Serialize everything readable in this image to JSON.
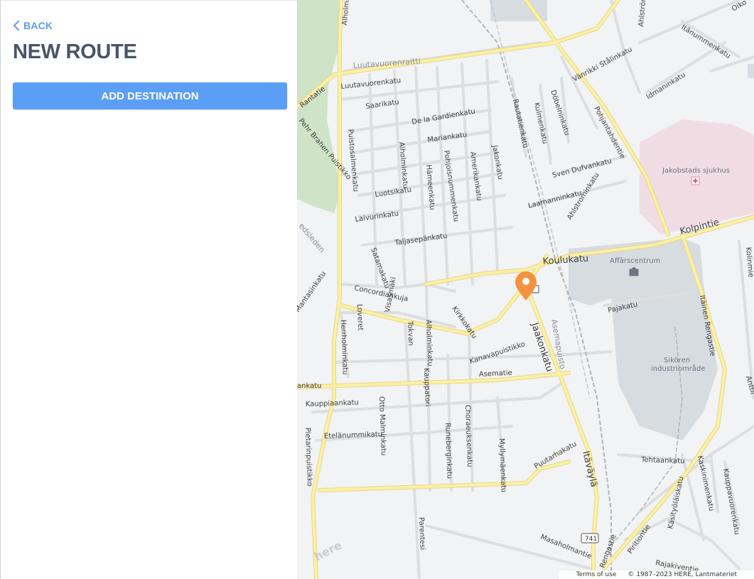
{
  "sidebar": {
    "back_label": "BACK",
    "title": "NEW ROUTE",
    "add_destination_label": "ADD DESTINATION"
  },
  "map": {
    "streets": {
      "luutavuorenraitti": "Luutavuorenraitti",
      "luutavuorenkatu": "Luutavuorenkatu",
      "rantatie": "Rantatie",
      "saarikatu": "Saarikatu",
      "de_la_gardienkatu": "De la Gardienkatu",
      "mariankatu": "Mariankatu",
      "per_brahen_puistikko": "Pehr Brahen Puistikko",
      "puistosalmenkatu": "Puistosalmenkatu",
      "alholminkatu_n": "Alholminkatu",
      "hameenkatu": "Hämeenkatu",
      "pohjoisnummenkatu": "Pohjoisnummenkatu",
      "amerikankatu": "Amerikankatu",
      "jakonkatu_n": "Jakonkatu",
      "rautatienkatu": "Rautatienkatu",
      "kulmenkatu": "Kulmenkatu",
      "dobelninkatu": "Döbelninkatu",
      "vanrikki_stalinkatu": "Vänrikki Stålinkatu",
      "pohjantahdentie": "Pohjantahdentie",
      "idmaninkatu": "Idmaninkatu",
      "itanummenkatu": "Itänummenkatu",
      "ahlstrom": "Ahlström",
      "sven_dufvankatu": "Sven Dufvankatu",
      "laamanninkatu": "Laamanninkatu",
      "ahlstrominkatu": "Ahlstrominkatu",
      "luotsikatu": "Luotsikatu",
      "laivurinkatu": "Laivurinkatu",
      "taljasepankatu": "Taljasepänkatu",
      "koulukatu": "Koulukatu",
      "kolpintie": "Kolpintie",
      "satamakatu": "Satamakatu",
      "concordiankuja": "Concordiankuja",
      "kirkkokatu": "Kirkkokatu",
      "herrholminkatu": "Herrholminkatu",
      "loveret": "Loveret",
      "visasmaki": "Visasmäki",
      "tokvaan": "Tokvan",
      "alholminkatu_s": "Alholminkatu",
      "kanavapuistikko": "Kanavapuistikko",
      "jaakonkatu": "Jaakonkatu",
      "asemapuisto": "Asemapuisto",
      "asematie": "Asematie",
      "kauppapuori": "Kauppatori",
      "kauppiaankatu": "Kauppiaankatu",
      "otto_malminkatu": "Otto Malminkatu",
      "etelanummikatu": "Etelänummikatu",
      "runebergintie": "Runeberginkatu",
      "chorausenkatu": "Choraeuksenkatu",
      "myllymaenkatu": "Myllymäenkatu",
      "puutarhakatu": "Puutarhakatu",
      "itavayla": "Itäväylä",
      "pietarinpuistikko": "Pietarinpuistikko",
      "parentesi": "Parentesi",
      "masaholmantie": "Masaholmantie",
      "rengastie": "Rengastie",
      "pirtiontie": "Piritiontie",
      "rajakiventie": "Rajakiventie",
      "kasityolaiskatu": "Käsityöläiskatu",
      "kaskinimenkatu": "Kaskinimenkatu",
      "kauppavuorenkatu": "Kauppavuorenkatu",
      "tehtaankatu": "Tehtaankatu",
      "itainen_rengastie": "Itäinen Rengastie",
      "pajakatu": "Pajakatu",
      "kolimmie": "Kolinmie",
      "anttila": "Anttil",
      "oiko": "Oiko",
      "mantasinkatu": "Mantasinkatu",
      "leidsleden": "edsleden",
      "ankatu": "ankatu",
      "alholmi": "Alholmi"
    },
    "pois": {
      "jakobstads_sjukhus": "Jakobstads sjukhus",
      "affarscentrum": "Affärscentrum",
      "sikoren": "Sikören",
      "industriomrade": "industriområde"
    },
    "route_shield": "741",
    "watermark": "here",
    "terms_label": "Terms of use",
    "copyright": "© 1987–2023 HERE, Lantmateriet"
  },
  "colors": {
    "accent": "#5b9ef5",
    "marker": "#f5923e",
    "major_road": "#fbf0a4",
    "hospital": "#f0dde4",
    "industrial": "#d7dce1",
    "park": "#cfe3c7"
  },
  "icons": {
    "back": "chevron-left-icon",
    "marker": "location-pin-icon",
    "hospital": "hospital-cross-icon",
    "shopping": "shopping-bag-icon"
  }
}
